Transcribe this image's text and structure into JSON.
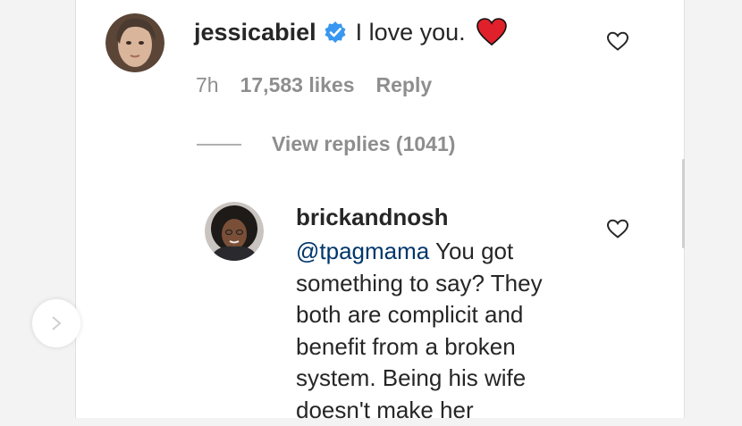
{
  "comment": {
    "username": "jessicabiel",
    "text": "I love you.",
    "time": "7h",
    "likes": "17,583 likes",
    "reply_label": "Reply",
    "view_replies": "View replies (1041)"
  },
  "reply": {
    "username": "brickandnosh",
    "mention": "@tpagmama",
    "text": " You got something to say? They both are complicit and benefit from a broken system. Being his wife doesn't make her"
  },
  "icons": {
    "verified": "verified-badge-icon",
    "heart_emoji": "red-heart-emoji",
    "like": "heart-outline-icon",
    "nav": "chevron-right-icon"
  },
  "colors": {
    "verified": "#3897f0",
    "mention": "#00376b",
    "muted": "#8e8e8e",
    "heart": "#e0202a"
  }
}
